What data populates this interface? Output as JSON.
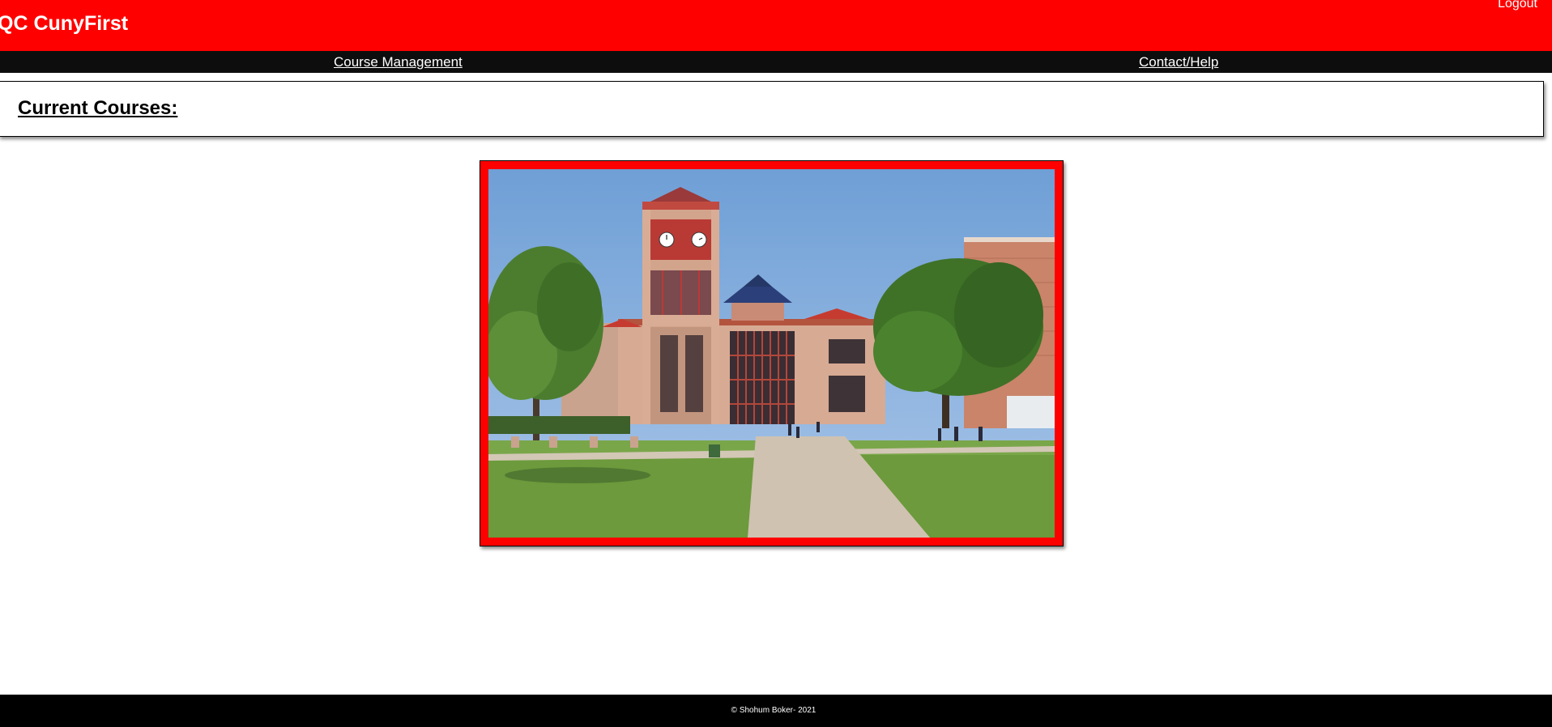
{
  "header": {
    "title": "QC CunyFirst",
    "logout_label": "Logout",
    "background_color": "#ff0000"
  },
  "nav": {
    "items": [
      {
        "label": "Course Management"
      },
      {
        "label": "Contact/Help"
      }
    ],
    "background_color": "#0d0d0d"
  },
  "main": {
    "courses_heading": "Current Courses:",
    "photo": {
      "frame_color": "#ff0000"
    }
  },
  "footer": {
    "copyright": "© Shohum Boker- 2021"
  }
}
